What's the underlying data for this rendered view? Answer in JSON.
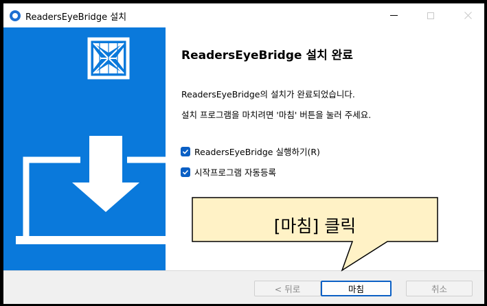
{
  "window": {
    "title": "ReadersEyeBridge 설치"
  },
  "main": {
    "heading": "ReadersEyeBridge 설치 완료",
    "description_line1": "ReadersEyeBridge의 설치가 완료되었습니다.",
    "description_line2": "설치 프로그램을 마치려면 '마침' 버튼을 눌러 주세요.",
    "checkboxes": [
      {
        "label": "ReadersEyeBridge 실행하기(R)",
        "checked": true
      },
      {
        "label": "시작프로그램 자동등록",
        "checked": true
      }
    ]
  },
  "callout": {
    "text": "[마침] 클릭"
  },
  "footer": {
    "back_label": "< 뒤로",
    "finish_label": "마침",
    "cancel_label": "취소"
  },
  "colors": {
    "brand_blue": "#0a79db",
    "checkbox_blue": "#0a5fc4",
    "callout_fill": "#fff2c6"
  }
}
